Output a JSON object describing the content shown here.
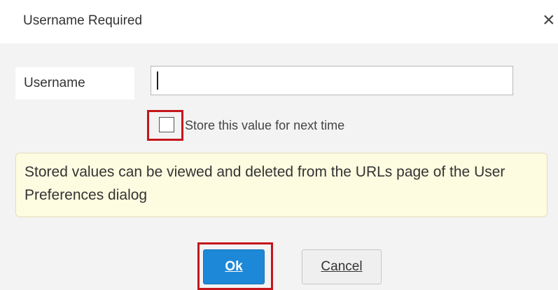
{
  "dialog": {
    "title": "Username Required",
    "close_icon": "close-icon"
  },
  "form": {
    "username_label": "Username",
    "username_value": "",
    "store_checkbox_label": "Store this value for next time",
    "store_checked": false
  },
  "info": {
    "text": "Stored values can be viewed and deleted from the URLs page of the User Preferences dialog"
  },
  "buttons": {
    "ok_label": "Ok",
    "cancel_label": "Cancel"
  },
  "colors": {
    "ok_button": "#1e88d8",
    "highlight": "#c4161c",
    "info_background": "#fdfce1"
  }
}
